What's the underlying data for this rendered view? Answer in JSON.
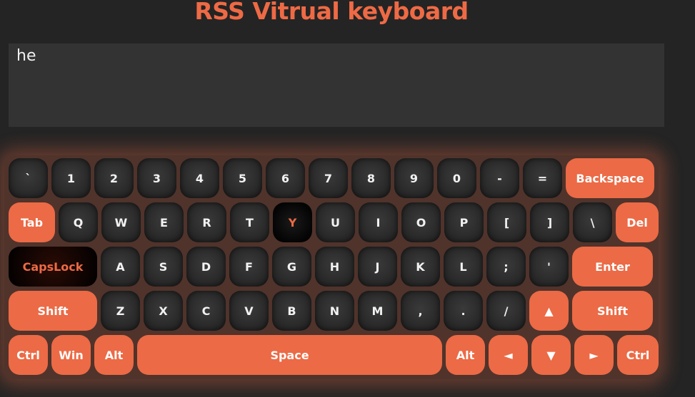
{
  "app": {
    "title": "RSS Vitrual keyboard"
  },
  "textarea": {
    "value": "he"
  },
  "colors": {
    "accent": "#ec6a45",
    "background": "#242424",
    "key_dark": "#2a2a2a",
    "textarea": "#333333"
  },
  "keyboard": {
    "rows": [
      [
        {
          "label": "`",
          "name": "key-backtick",
          "style": "dark",
          "width": 55
        },
        {
          "label": "1",
          "name": "key-1",
          "style": "dark",
          "width": 55
        },
        {
          "label": "2",
          "name": "key-2",
          "style": "dark",
          "width": 55
        },
        {
          "label": "3",
          "name": "key-3",
          "style": "dark",
          "width": 55
        },
        {
          "label": "4",
          "name": "key-4",
          "style": "dark",
          "width": 55
        },
        {
          "label": "5",
          "name": "key-5",
          "style": "dark",
          "width": 55
        },
        {
          "label": "6",
          "name": "key-6",
          "style": "dark",
          "width": 55
        },
        {
          "label": "7",
          "name": "key-7",
          "style": "dark",
          "width": 55
        },
        {
          "label": "8",
          "name": "key-8",
          "style": "dark",
          "width": 55
        },
        {
          "label": "9",
          "name": "key-9",
          "style": "dark",
          "width": 55
        },
        {
          "label": "0",
          "name": "key-0",
          "style": "dark",
          "width": 55
        },
        {
          "label": "-",
          "name": "key-minus",
          "style": "dark",
          "width": 55
        },
        {
          "label": "=",
          "name": "key-equals",
          "style": "dark",
          "width": 55
        },
        {
          "label": "Backspace",
          "name": "key-backspace",
          "style": "orange",
          "width": 124
        }
      ],
      [
        {
          "label": "Tab",
          "name": "key-tab",
          "style": "orange",
          "width": 65
        },
        {
          "label": "Q",
          "name": "key-q",
          "style": "dark",
          "width": 55
        },
        {
          "label": "W",
          "name": "key-w",
          "style": "dark",
          "width": 55
        },
        {
          "label": "E",
          "name": "key-e",
          "style": "dark",
          "width": 55
        },
        {
          "label": "R",
          "name": "key-r",
          "style": "dark",
          "width": 55
        },
        {
          "label": "T",
          "name": "key-t",
          "style": "dark",
          "width": 55
        },
        {
          "label": "Y",
          "name": "key-y",
          "style": "active",
          "width": 55
        },
        {
          "label": "U",
          "name": "key-u",
          "style": "dark",
          "width": 55
        },
        {
          "label": "I",
          "name": "key-i",
          "style": "dark",
          "width": 55
        },
        {
          "label": "O",
          "name": "key-o",
          "style": "dark",
          "width": 55
        },
        {
          "label": "P",
          "name": "key-p",
          "style": "dark",
          "width": 55
        },
        {
          "label": "[",
          "name": "key-left-bracket",
          "style": "dark",
          "width": 55
        },
        {
          "label": "]",
          "name": "key-right-bracket",
          "style": "dark",
          "width": 55
        },
        {
          "label": "\\",
          "name": "key-backslash",
          "style": "dark",
          "width": 55
        },
        {
          "label": "Del",
          "name": "key-del",
          "style": "orange",
          "width": 60
        }
      ],
      [
        {
          "label": "CapsLock",
          "name": "key-capslock",
          "style": "caps-on",
          "width": 124
        },
        {
          "label": "A",
          "name": "key-a",
          "style": "dark",
          "width": 55
        },
        {
          "label": "S",
          "name": "key-s",
          "style": "dark",
          "width": 55
        },
        {
          "label": "D",
          "name": "key-d",
          "style": "dark",
          "width": 55
        },
        {
          "label": "F",
          "name": "key-f",
          "style": "dark",
          "width": 55
        },
        {
          "label": "G",
          "name": "key-g",
          "style": "dark",
          "width": 55
        },
        {
          "label": "H",
          "name": "key-h",
          "style": "dark",
          "width": 55
        },
        {
          "label": "J",
          "name": "key-j",
          "style": "dark",
          "width": 55
        },
        {
          "label": "K",
          "name": "key-k",
          "style": "dark",
          "width": 55
        },
        {
          "label": "L",
          "name": "key-l",
          "style": "dark",
          "width": 55
        },
        {
          "label": ";",
          "name": "key-semicolon",
          "style": "dark",
          "width": 55
        },
        {
          "label": "'",
          "name": "key-quote",
          "style": "dark",
          "width": 55
        },
        {
          "label": "Enter",
          "name": "key-enter",
          "style": "orange",
          "width": 113
        }
      ],
      [
        {
          "label": "Shift",
          "name": "key-shift-left",
          "style": "orange",
          "width": 124
        },
        {
          "label": "Z",
          "name": "key-z",
          "style": "dark",
          "width": 55
        },
        {
          "label": "X",
          "name": "key-x",
          "style": "dark",
          "width": 55
        },
        {
          "label": "C",
          "name": "key-c",
          "style": "dark",
          "width": 55
        },
        {
          "label": "V",
          "name": "key-v",
          "style": "dark",
          "width": 55
        },
        {
          "label": "B",
          "name": "key-b",
          "style": "dark",
          "width": 55
        },
        {
          "label": "N",
          "name": "key-n",
          "style": "dark",
          "width": 55
        },
        {
          "label": "M",
          "name": "key-m",
          "style": "dark",
          "width": 55
        },
        {
          "label": ",",
          "name": "key-comma",
          "style": "dark",
          "width": 55
        },
        {
          "label": ".",
          "name": "key-period",
          "style": "dark",
          "width": 55
        },
        {
          "label": "/",
          "name": "key-slash",
          "style": "dark",
          "width": 55
        },
        {
          "label": "▲",
          "name": "key-arrow-up",
          "style": "orange",
          "width": 55
        },
        {
          "label": "Shift",
          "name": "key-shift-right",
          "style": "orange",
          "width": 113
        }
      ],
      [
        {
          "label": "Ctrl",
          "name": "key-ctrl-left",
          "style": "orange",
          "width": 55
        },
        {
          "label": "Win",
          "name": "key-win",
          "style": "orange",
          "width": 55
        },
        {
          "label": "Alt",
          "name": "key-alt-left",
          "style": "orange",
          "width": 55
        },
        {
          "label": "Space",
          "name": "key-space",
          "style": "orange",
          "width": 427
        },
        {
          "label": "Alt",
          "name": "key-alt-right",
          "style": "orange",
          "width": 55
        },
        {
          "label": "◄",
          "name": "key-arrow-left",
          "style": "orange",
          "width": 55
        },
        {
          "label": "▼",
          "name": "key-arrow-down",
          "style": "orange",
          "width": 55
        },
        {
          "label": "►",
          "name": "key-arrow-right",
          "style": "orange",
          "width": 55
        },
        {
          "label": "Ctrl",
          "name": "key-ctrl-right",
          "style": "orange",
          "width": 58
        }
      ]
    ]
  }
}
